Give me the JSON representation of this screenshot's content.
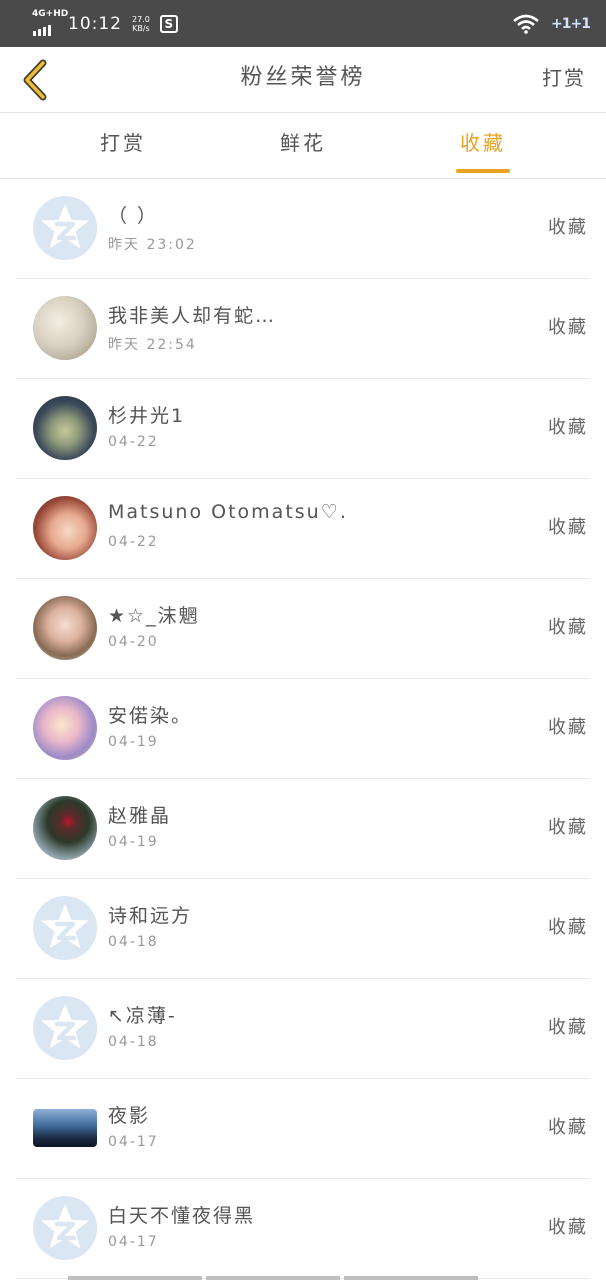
{
  "status_bar": {
    "network": "4G+HD",
    "time": "10:12",
    "speed_value": "27.0",
    "speed_unit": "KB/s",
    "app_icon_letter": "S",
    "battery": "+1+1"
  },
  "navbar": {
    "title": "粉丝荣誉榜",
    "action_label": "打赏"
  },
  "tabs": [
    {
      "label": "打赏",
      "active": false
    },
    {
      "label": "鲜花",
      "active": false
    },
    {
      "label": "收藏",
      "active": true
    }
  ],
  "colors": {
    "accent": "#e8a323",
    "status_bar": "#4a4a4a",
    "divider": "#e9e9e9",
    "default_avatar": "#dbe6f3"
  },
  "fans": [
    {
      "name": "（ ）",
      "date": "昨天 23:02",
      "action": "收藏",
      "avatar": "default-avatar-icon"
    },
    {
      "name": "我非美人却有蛇…",
      "date": "昨天 22:54",
      "action": "收藏",
      "avatar": "photo-avatar"
    },
    {
      "name": "杉井光1",
      "date": "04-22",
      "action": "收藏",
      "avatar": "photo-avatar"
    },
    {
      "name": "Matsuno Otomatsu♡…",
      "date": "04-22",
      "action": "收藏",
      "avatar": "photo-avatar"
    },
    {
      "name": "★☆_沫魍",
      "date": "04-20",
      "action": "收藏",
      "avatar": "photo-avatar"
    },
    {
      "name": "安偌染。",
      "date": "04-19",
      "action": "收藏",
      "avatar": "photo-avatar"
    },
    {
      "name": "赵雅晶",
      "date": "04-19",
      "action": "收藏",
      "avatar": "photo-avatar"
    },
    {
      "name": "诗和远方",
      "date": "04-18",
      "action": "收藏",
      "avatar": "default-avatar-icon"
    },
    {
      "name": "↖凉薄-",
      "date": "04-18",
      "action": "收藏",
      "avatar": "default-avatar-icon"
    },
    {
      "name": "夜影",
      "date": "04-17",
      "action": "收藏",
      "avatar": "photo-avatar"
    },
    {
      "name": "白天不懂夜得黑",
      "date": "04-17",
      "action": "收藏",
      "avatar": "default-avatar-icon"
    }
  ]
}
